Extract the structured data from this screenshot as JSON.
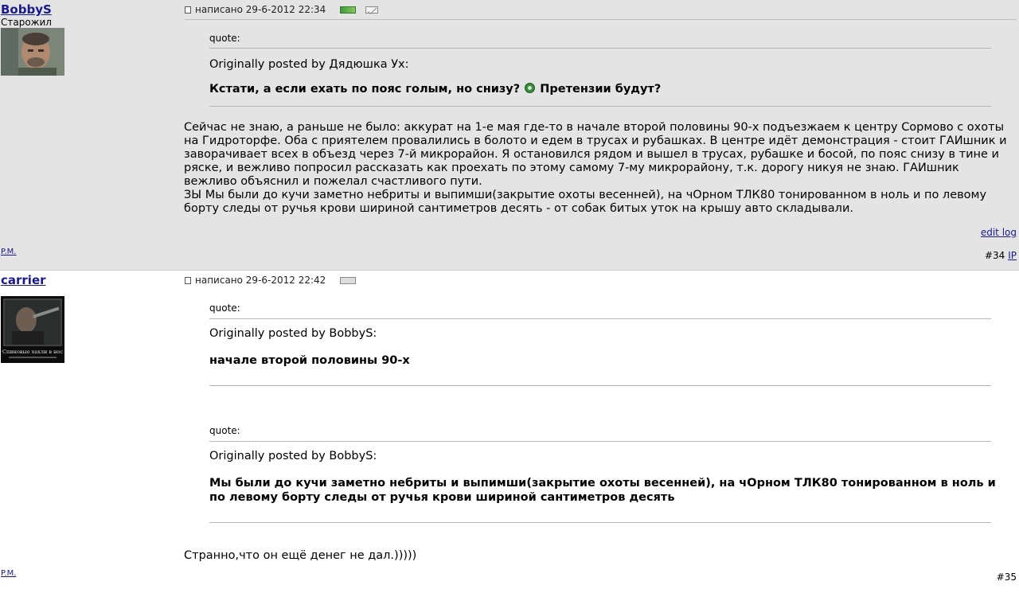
{
  "posts": [
    {
      "username": "BobbyS",
      "user_title": "Старожил",
      "avatar_icon": "user-photo",
      "pm_label": "P.M.",
      "date": "написано 29-6-2012 22:34",
      "quote": {
        "label": "quote:",
        "author": "Originally posted by Дядюшка Ух:",
        "text_before": "Кстати, а если ехать по пояс голым, но снизу?",
        "smiley_icon": "smiley-icon",
        "text_after": "Претензии будут?"
      },
      "body_lines": [
        "Сейчас не знаю, а раньше не было: аккурат на 1-е мая где-то в начале второй половины 90-х подъезжаем к центру Сормово с охоты на Гидроторфе. Оба с приятелем провалились в болото и едем в трусах и рубашках. В центре идёт демонстрация - стоит ГАИшник и заворачивает всех в объезд через 7-й микрорайон. Я остановился рядом и вышел в трусах, рубашке и босой, по пояс снизу в тине и ряске, и вежливо попросил рассказать как проехать по этому самому 7-му микрорайону, т.к. дорогу никуя не знаю. ГАИшник вежливо объяснил и пожелал счастливого пути.",
        "ЗЫ Мы были до кучи заметно небриты и выпимши(закрытие охоты весенней), на чОрном ТЛК80 тонированном в ноль и по левому борту следы от ручья крови шириной сантиметров десять - от собак битых уток на крышу авто складывали."
      ],
      "edit_log": "edit log",
      "post_number": "#34",
      "ip_label": "IP"
    },
    {
      "username": "carrier",
      "avatar_icon": "user-avatar-poster",
      "avatar_caption": "Спиновые хахли в нос",
      "pm_label": "P.M.",
      "date": "написано 29-6-2012 22:42",
      "quotes": [
        {
          "label": "quote:",
          "author": "Originally posted by BobbyS:",
          "text": "начале второй половины 90-х"
        },
        {
          "label": "quote:",
          "author": "Originally posted by BobbyS:",
          "text": "Мы были до кучи заметно небриты и выпимши(закрытие охоты весенней), на чОрном ТЛК80 тонированном в ноль и по левому борту следы от ручья крови шириной сантиметров десять"
        }
      ],
      "body": "Странно,что он ещё денег не дал.)))))",
      "post_number": "#35"
    }
  ]
}
